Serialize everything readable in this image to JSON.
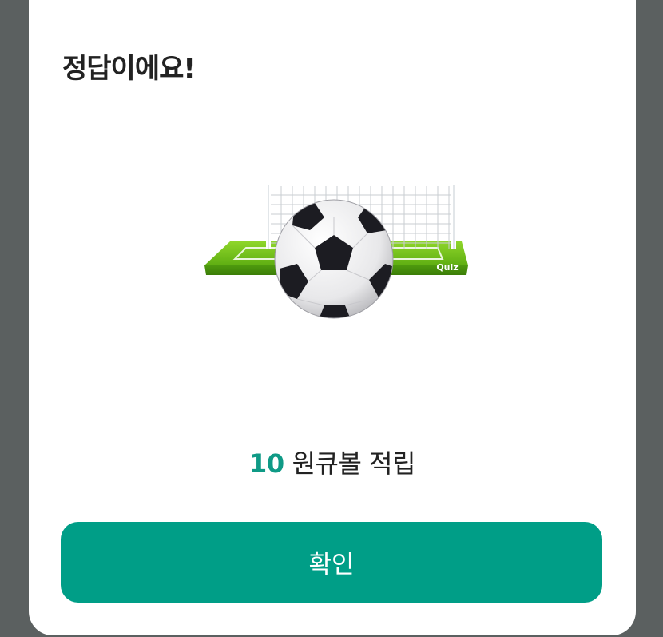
{
  "dialog": {
    "title": "정답이에요!",
    "illustration": {
      "icon": "soccer-goal-ball-icon",
      "goal_label": "Quiz"
    },
    "reward": {
      "amount": "10",
      "text": "원큐볼 적립"
    },
    "confirm_label": "확인"
  },
  "colors": {
    "accent": "#009e87",
    "amount": "#0f9a86",
    "backdrop": "#5b6060",
    "turf": "#6dbf1b"
  }
}
